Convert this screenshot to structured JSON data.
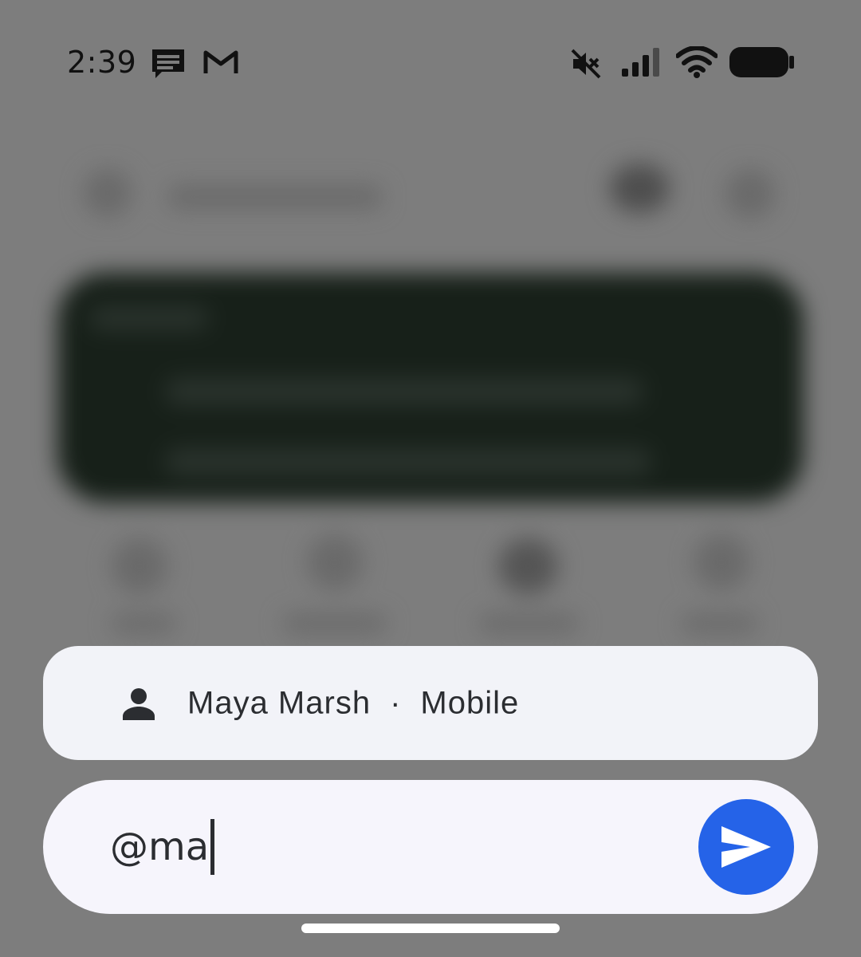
{
  "status_bar": {
    "time": "2:39",
    "left_icons": [
      "chat-message-icon",
      "gmail-icon"
    ],
    "right_icons": [
      "mute-icon",
      "cellular-signal-icon",
      "wifi-icon",
      "battery-icon"
    ]
  },
  "suggestion": {
    "icon": "person-icon",
    "name": "Maya Marsh",
    "separator": "·",
    "type": "Mobile"
  },
  "compose": {
    "value": "@ma",
    "send_icon": "send-icon"
  },
  "colors": {
    "scrim": "#7d7d7d",
    "chip_background": "#f2f3f8",
    "compose_background": "#f6f5fc",
    "send_button": "#2563e8",
    "text": "#2b2d31"
  }
}
